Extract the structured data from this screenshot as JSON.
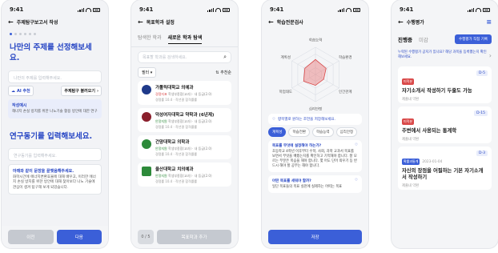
{
  "status_time": "9:41",
  "screen1": {
    "header": "주제탐구보고서 작성",
    "dots": [
      true,
      false,
      false,
      false,
      false,
      false
    ],
    "title": "나만의 주제를 선정해보세요.",
    "input_placeholder": "나만의 주제를 입력해주세요.",
    "ai_button": "AI 추천",
    "load_button": "주제탐구 불러오기",
    "hint_title": "작성예시",
    "hint_body": "해너지 손실 방지를 위한 나노기술 활용 방안에 대한 연구",
    "title2": "연구동기를 입력해보세요.",
    "input2_placeholder": "연구동기를 입력해주세요.",
    "hint2_title": "아래와 같이 문장을 끝맺음해주세요.",
    "hint2_body": "화학시간에 에너지변환효율에 대해 배우고, 이러한 에너지 손실 방지를 위한 방안에 대해 찾아보다 나노 기술에 관심이 생겨 탐구해 보게 되었습니다.",
    "prev_button": "이전",
    "next_button": "다음"
  },
  "screen2": {
    "header": "목표학과 설정",
    "tabs": [
      "탐색한 학과",
      "새로운 학과 탐색"
    ],
    "search_placeholder": "목표할 학과를 검색하세요.",
    "filter": "필터",
    "sort": "추천순",
    "universities": [
      {
        "name": "가톨릭대학교 의예과",
        "meta_red": "경쟁지표",
        "meta": "학생부종합(교과) · 내 등급(2.0)",
        "meta2": "경쟁률 10.4 · 작년결 합격률률",
        "logo": "#1f3a8a"
      },
      {
        "name": "덕성여자대학교 약학과 (6년제)",
        "meta_red": "안정지원",
        "meta": "학생부종합(교과) · 내 등급(2.0)",
        "meta2": "경쟁률 10.4 · 작년결 합격률률",
        "logo": "#8a1f2c"
      },
      {
        "name": "건양대학교 의학과",
        "meta_red": "안정지원",
        "meta": "학생부종합(교과) · 내 등급(2.0)",
        "meta2": "경쟁률 10.4 · 작년결 합격률률",
        "logo": "#2d8a3a"
      },
      {
        "name": "을산대학교 치의예과",
        "meta_red": "안정지원",
        "meta": "학생부종합(교과) · 내 등급(2.0)",
        "meta2": "경쟁률 10.4 · 작년결 합격률률",
        "logo": "#2d8a3a"
      }
    ],
    "count": "0 / 5",
    "add_button": "목표학과 추가"
  },
  "screen3": {
    "header": "학습전문검사",
    "radar_labels": [
      "학습능력",
      "학습환경",
      "인간관계",
      "심리안정",
      "학업태도",
      "계획성"
    ],
    "radar_values": [
      0.55,
      0.45,
      0.35,
      0.4,
      0.5,
      0.45
    ],
    "note": "향목별로 원하는 조언을 저장해보세요.",
    "pills": [
      "계획성",
      "학습전환",
      "학습능력",
      "심리안정"
    ],
    "q1_title": "목표를 무엇에 설정해야 하는가?",
    "q1_body": "초등학교 4학년 이후부터 수학, 사회, 과학 교과서 목표를 보면서 무엇을 배웠는지를 확인하고 기억해야 합니다. 잘 모르는 부분은 복습을 해야 합니다. 몇 어도 단어 외우기 등 반드시 해야 할 공부는 해야 합니다.",
    "q2_title": "어떤 목표를 세워야 할까?",
    "q2_body": "일단 목표들의 목표 실천에 실제하는 어떠는 목표",
    "save_button": "저장"
  },
  "screen4": {
    "header": "수행평가",
    "tabs": [
      "진행중",
      "미감"
    ],
    "direct_button": "수행평가 직접 기록",
    "info": "누락된 수행평가 공지가 있나요? 해당 과목을 등록했는지 확인해보세요.",
    "tasks": [
      {
        "tag": "미적분",
        "tag_color": "red",
        "dday": "D-5",
        "title": "자기소개서 작성하기 두줄도 가능",
        "sub": "제출내 약환",
        "date": ""
      },
      {
        "tag": "미적분",
        "tag_color": "red",
        "dday": "D-15",
        "title": "주변에서 사용되는 통계학",
        "sub": "제출내 약환",
        "date": ""
      },
      {
        "tag": "확률과통계",
        "tag_color": "blue",
        "dday": "D-3",
        "title": "자신의 장점을 어필하는 기본 자기소개서 작성하기",
        "sub": "제출내 약환",
        "date": "2023-01-04"
      }
    ]
  }
}
